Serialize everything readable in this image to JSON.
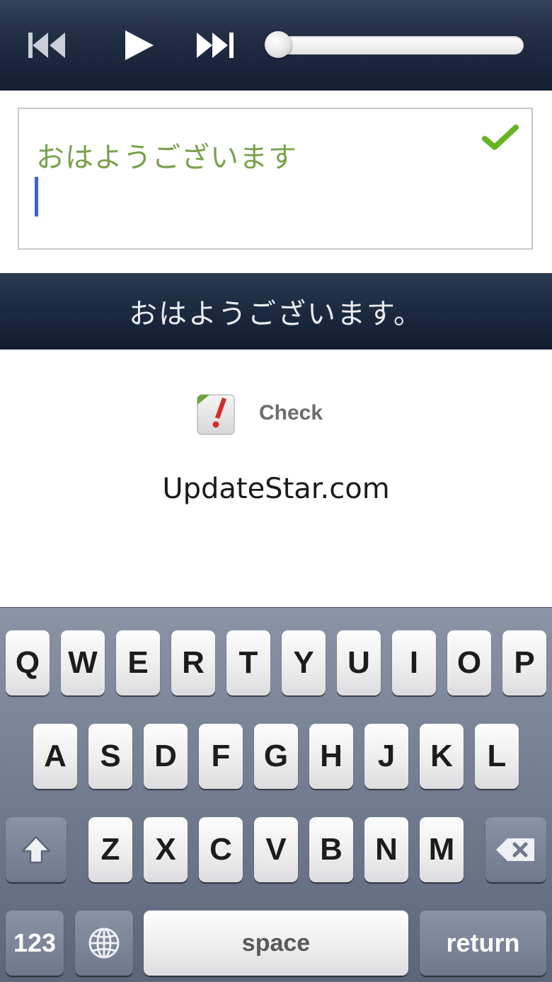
{
  "media": {
    "prev_icon": "skip-back-icon",
    "play_icon": "play-icon",
    "next_icon": "skip-forward-icon",
    "progress": 0.0
  },
  "answer": {
    "text": "おはようございます",
    "status_icon": "checkmark-icon",
    "status_color": "#66b422"
  },
  "reference": {
    "text": "おはようございます。"
  },
  "check": {
    "icon": "check-warning-icon",
    "label": "Check"
  },
  "watermark": "UpdateStar.com",
  "keyboard": {
    "row1": [
      "Q",
      "W",
      "E",
      "R",
      "T",
      "Y",
      "U",
      "I",
      "O",
      "P"
    ],
    "row2": [
      "A",
      "S",
      "D",
      "F",
      "G",
      "H",
      "J",
      "K",
      "L"
    ],
    "row3": [
      "Z",
      "X",
      "C",
      "V",
      "B",
      "N",
      "M"
    ],
    "shift_icon": "shift-icon",
    "delete_icon": "delete-icon",
    "numbers_label": "123",
    "globe_icon": "globe-icon",
    "space_label": "space",
    "return_label": "return"
  }
}
